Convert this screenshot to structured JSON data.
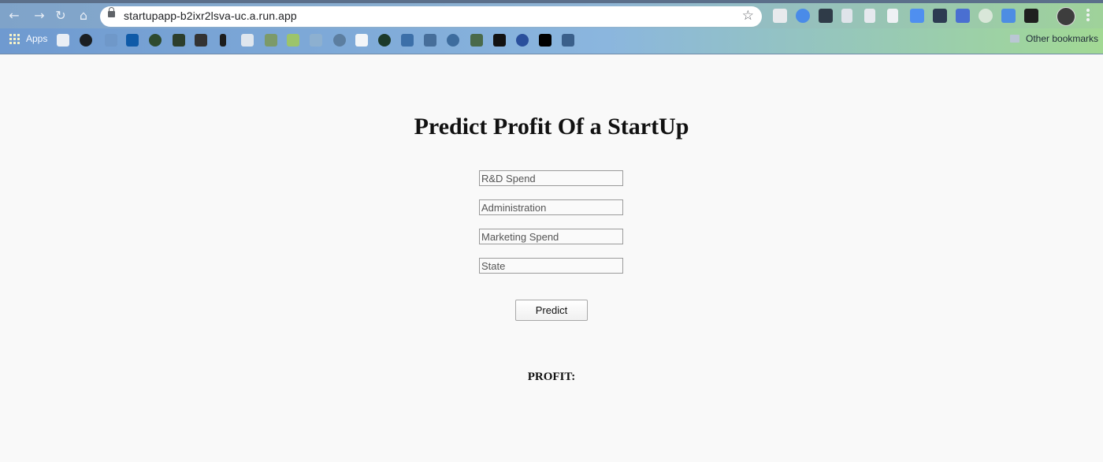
{
  "browser": {
    "url": "startupapp-b2ixr2lsva-uc.a.run.app",
    "bookmarks_bar": {
      "apps_label": "Apps",
      "other_bookmarks_label": "Other bookmarks"
    }
  },
  "icons": {
    "back": "arrow-left-icon",
    "forward": "arrow-right-icon",
    "reload": "reload-icon",
    "home": "home-icon",
    "secure": "lock-icon",
    "bookmark_star": "star-icon"
  },
  "page": {
    "title": "Predict Profit Of a StartUp",
    "form": {
      "rd_spend_placeholder": "R&D Spend",
      "administration_placeholder": "Administration",
      "marketing_spend_placeholder": "Marketing Spend",
      "state_placeholder": "State",
      "submit_label": "Predict"
    },
    "result_label": "PROFIT:"
  }
}
